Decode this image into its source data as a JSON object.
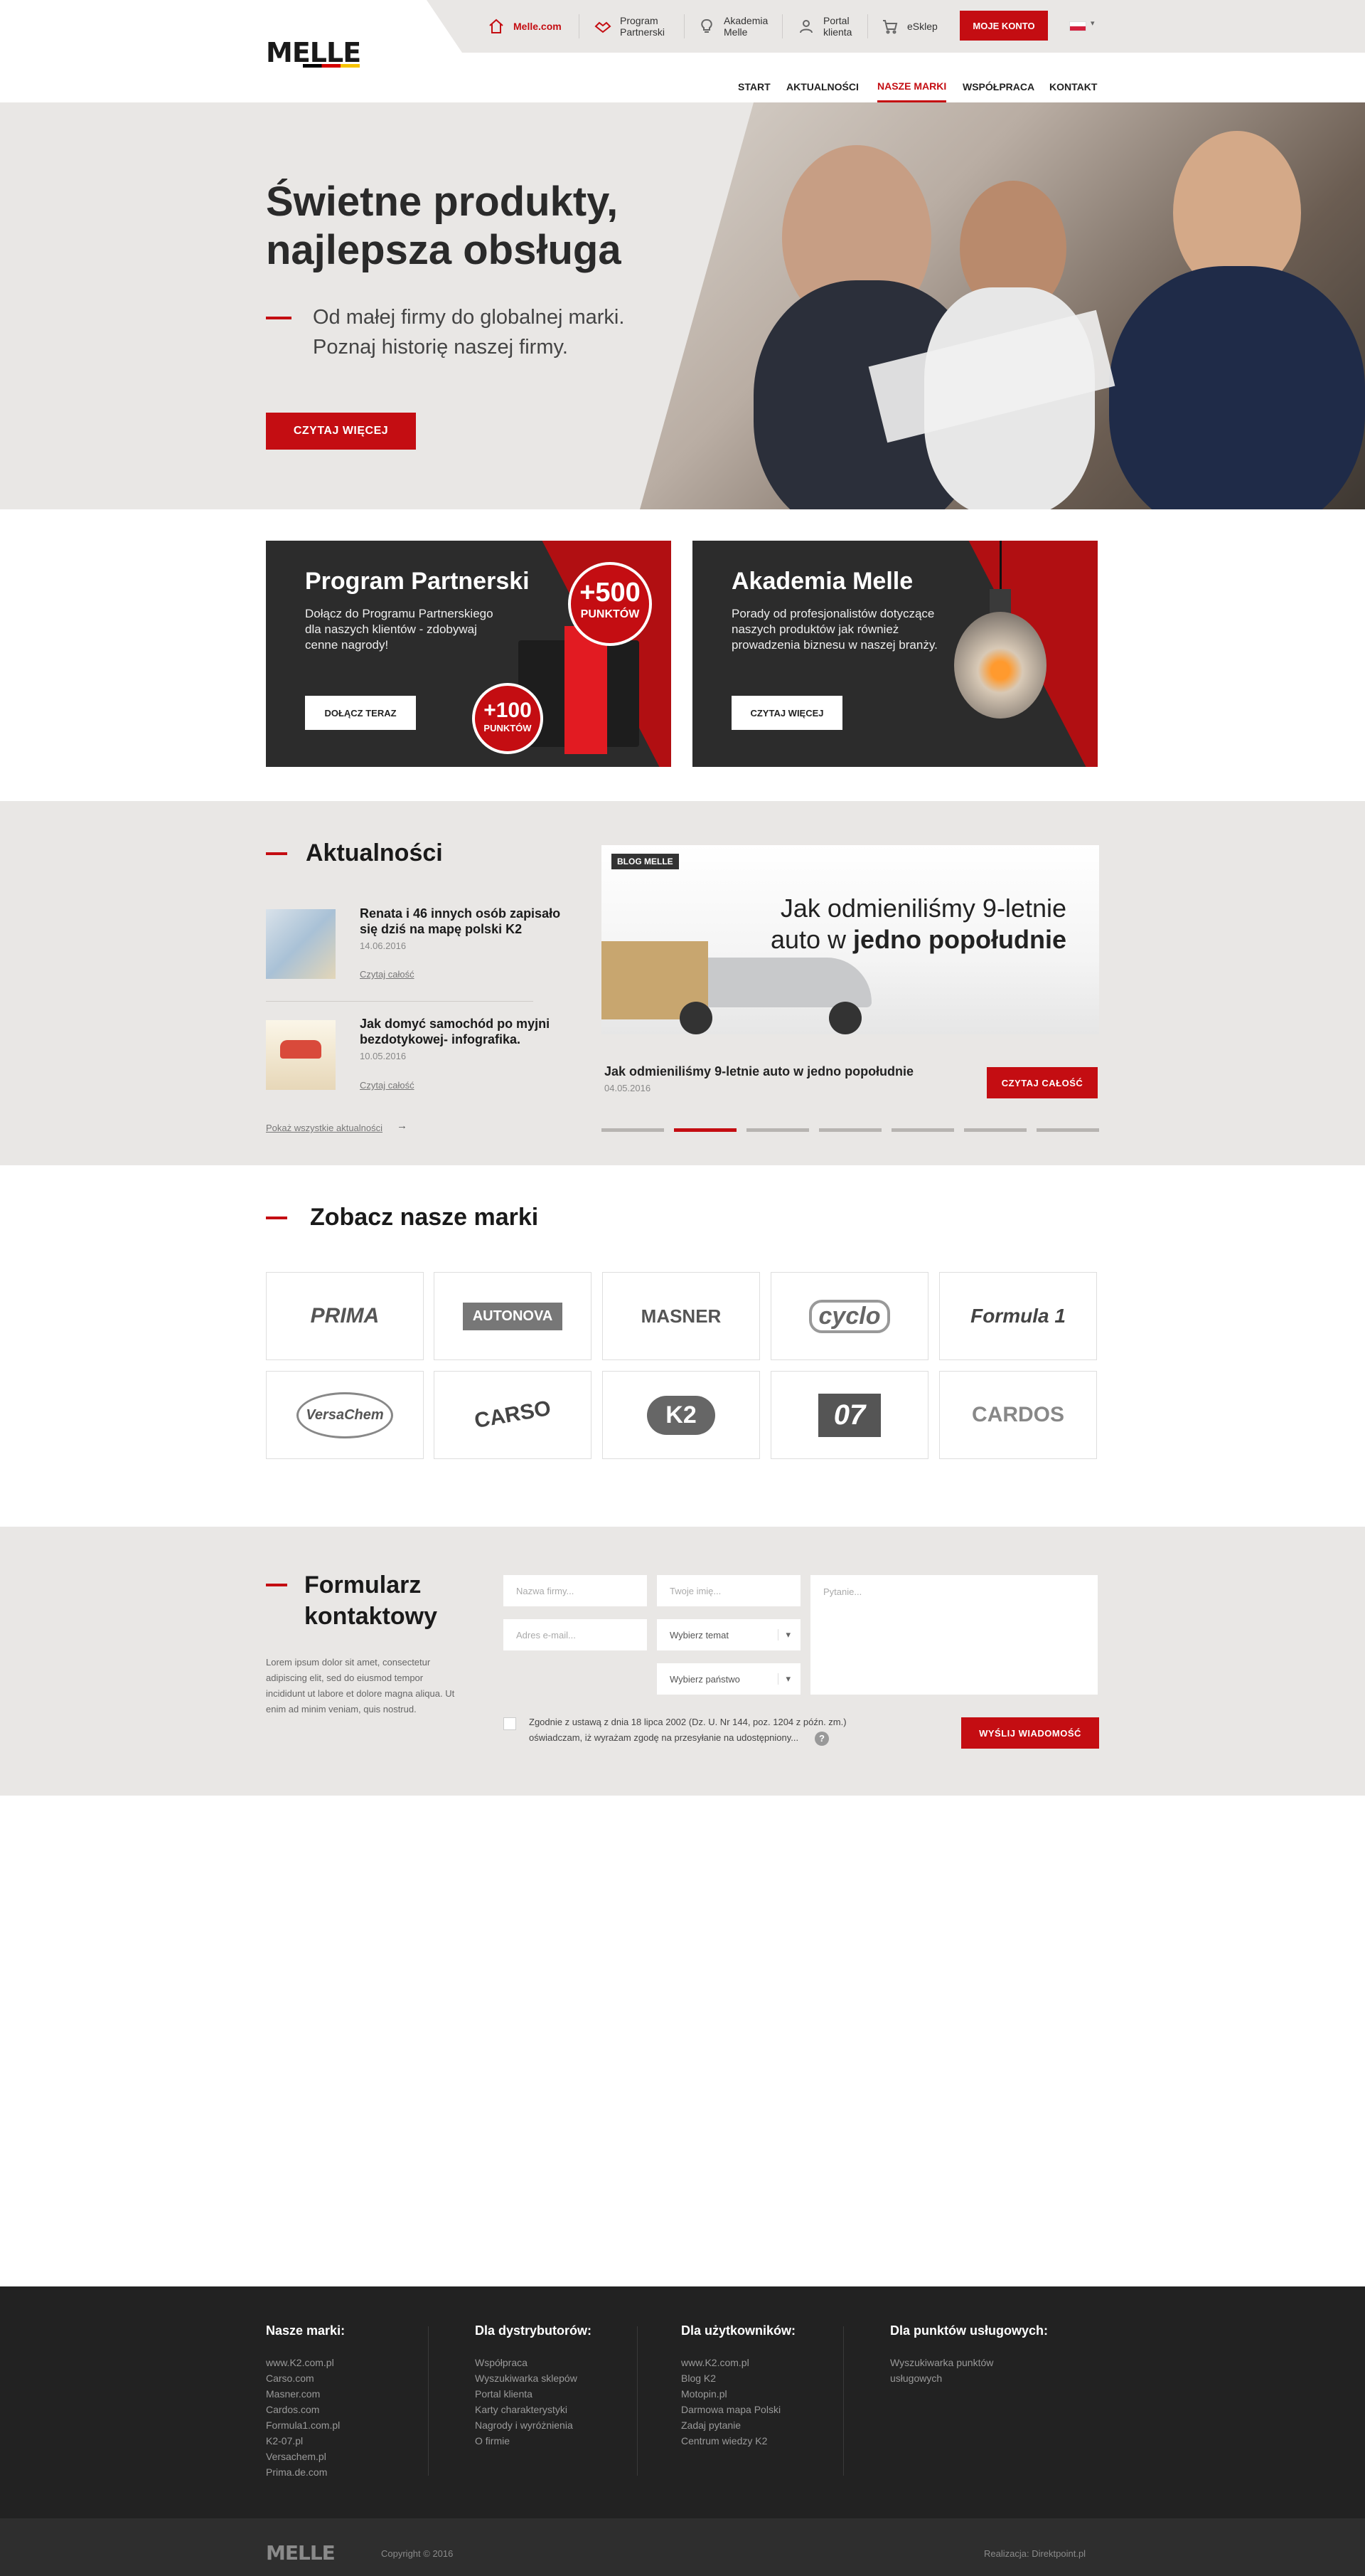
{
  "brand": {
    "logo_text": "MELLE"
  },
  "topbar": {
    "items": [
      {
        "label": "Melle.com",
        "icon": "home-icon"
      },
      {
        "label_1": "Program",
        "label_2": "Partnerski",
        "icon": "handshake-icon"
      },
      {
        "label_1": "Akademia",
        "label_2": "Melle",
        "icon": "bulb-icon"
      },
      {
        "label_1": "Portal",
        "label_2": "klienta",
        "icon": "user-icon"
      },
      {
        "label": "eSklep",
        "icon": "cart-icon"
      }
    ],
    "account_button": "MOJE KONTO",
    "language": "PL"
  },
  "nav": {
    "items": [
      "START",
      "AKTUALNOŚCI",
      "NASZE MARKI",
      "WSPÓŁPRACA",
      "KONTAKT"
    ],
    "active": "NASZE MARKI"
  },
  "hero": {
    "title_1": "Świetne produkty,",
    "title_2": "najlepsza obsługa",
    "sub_1": "Od małej firmy do globalnej marki.",
    "sub_2": "Poznaj historię naszej firmy.",
    "button": "CZYTAJ WIĘCEJ"
  },
  "promos": [
    {
      "title": "Program Partnerski",
      "text": "Dołącz do Programu Partnerskiego dla naszych klientów - zdobywaj cenne nagrody!",
      "button": "DOŁĄCZ TERAZ",
      "badge_big": "+500",
      "badge_big_sub": "PUNKTÓW",
      "badge_small": "+100",
      "badge_small_sub": "PUNKTÓW"
    },
    {
      "title": "Akademia Melle",
      "text": "Porady od profesjonalistów dotyczące naszych produktów jak również prowadzenia biznesu w naszej branży.",
      "button": "CZYTAJ WIĘCEJ"
    }
  ],
  "news": {
    "heading": "Aktualności",
    "items": [
      {
        "title": "Renata i 46 innych osób zapisało się dziś na mapę polski K2",
        "date": "14.06.2016",
        "more": "Czytaj całość"
      },
      {
        "title": "Jak domyć samochód po myjni bezdotykowej- infografika.",
        "date": "10.05.2016",
        "more": "Czytaj całość"
      }
    ],
    "all_link": "Pokaż wszystkie aktualności",
    "blog": {
      "tag": "BLOG MELLE",
      "headline_1": "Jak odmieniliśmy 9-letnie",
      "headline_2a": "auto w ",
      "headline_2b": "jedno popołudnie",
      "caption": "Jak odmieniliśmy 9-letnie auto w jedno popołudnie",
      "date": "04.05.2016",
      "button": "CZYTAJ CAŁOŚĆ"
    }
  },
  "brands": {
    "heading": "Zobacz nasze marki",
    "items": [
      "PRIMA",
      "AUTONOVA",
      "MASNER",
      "cyclo",
      "Formula 1",
      "VersaChem",
      "CARSO",
      "K2",
      "07",
      "CARDOS"
    ]
  },
  "form": {
    "heading_1": "Formularz",
    "heading_2": "kontaktowy",
    "text": "Lorem ipsum dolor sit amet, consectetur adipiscing elit, sed do eiusmod tempor incididunt ut labore et dolore magna aliqua. Ut enim ad minim veniam, quis nostrud.",
    "company_ph": "Nazwa firmy...",
    "name_ph": "Twoje imię...",
    "email_ph": "Adres e-mail...",
    "topic": "Wybierz temat",
    "country": "Wybierz państwo",
    "question_ph": "Pytanie...",
    "consent_1": "Zgodnie z ustawą z dnia 18 lipca 2002 (Dz. U. Nr 144, poz. 1204 z późn. zm.)",
    "consent_2": "oświadczam, iż wyrażam zgodę na przesyłanie na udostępniony...",
    "submit": "WYŚLIJ WIADOMOŚĆ"
  },
  "footer": {
    "columns": [
      {
        "heading": "Nasze marki:",
        "links": [
          "www.K2.com.pl",
          "Carso.com",
          "Masner.com",
          "Cardos.com",
          "Formula1.com.pl",
          "K2-07.pl",
          "Versachem.pl",
          "Prima.de.com"
        ]
      },
      {
        "heading": "Dla dystrybutorów:",
        "links": [
          "Współpraca",
          "Wyszukiwarka sklepów",
          "Portal klienta",
          "Karty charakterystyki",
          "Nagrody i wyróżnienia",
          "O firmie"
        ]
      },
      {
        "heading": "Dla użytkowników:",
        "links": [
          "www.K2.com.pl",
          "Blog K2",
          "Motopin.pl",
          "Darmowa mapa Polski",
          "Zadaj pytanie",
          "Centrum wiedzy K2"
        ]
      },
      {
        "heading": "Dla punktów usługowych:",
        "links": [
          "Wyszukiwarka punktów usługowych"
        ]
      }
    ],
    "copyright": "Copyright © 2016",
    "credit": "Realizacja: Direktpoint.pl"
  }
}
